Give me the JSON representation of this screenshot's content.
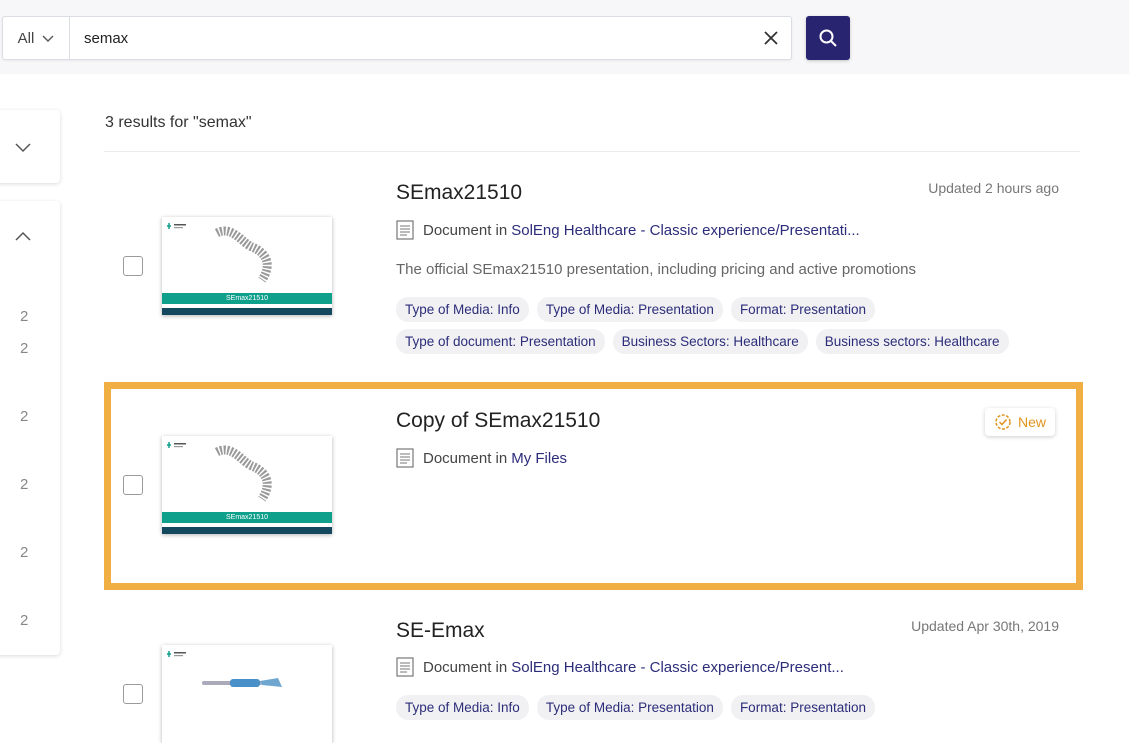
{
  "search": {
    "scope_label": "All",
    "query": "semax",
    "clear_icon": "close-icon",
    "submit_icon": "search-icon"
  },
  "sidebar": {
    "counts": [
      "2",
      "2",
      "2",
      "2",
      "2",
      "2"
    ]
  },
  "results_header": "3 results for \"semax\"",
  "colors": {
    "accent": "#28246f",
    "link": "#2c2d7a",
    "highlight": "#f0ae43",
    "badge": "#e0951f",
    "thumb_bar": "#0fa08c"
  },
  "results": [
    {
      "title": "SEmax21510",
      "updated": "Updated 2 hours ago",
      "type_prefix": "Document in",
      "location": "SolEng Healthcare - Classic experience/Presentati...",
      "description": "The official SEmax21510 presentation, including pricing and active promotions",
      "thumb_caption": "SEmax21510",
      "tags_row1": [
        "Type of Media: Info",
        "Type of Media: Presentation",
        "Format: Presentation"
      ],
      "tags_row2": [
        "Type of document: Presentation",
        "Business Sectors: Healthcare",
        "Business sectors: Healthcare"
      ]
    },
    {
      "title": "Copy of SEmax21510",
      "badge": "New",
      "type_prefix": "Document in",
      "location": "My Files",
      "thumb_caption": "SEmax21510"
    },
    {
      "title": "SE-Emax",
      "updated": "Updated Apr 30th, 2019",
      "type_prefix": "Document in",
      "location": "SolEng Healthcare - Classic experience/Present...",
      "tags_row1": [
        "Type of Media: Info",
        "Type of Media: Presentation",
        "Format: Presentation"
      ]
    }
  ]
}
